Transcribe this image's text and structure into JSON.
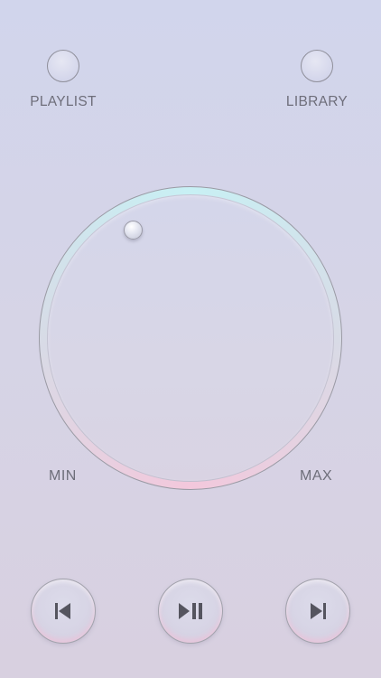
{
  "top_controls": {
    "playlist_label": "PLAYLIST",
    "library_label": "LIBRARY"
  },
  "dial": {
    "min_label": "MIN",
    "max_label": "MAX"
  },
  "playback": {
    "previous_icon": "skip-previous-icon",
    "play_pause_icon": "play-pause-icon",
    "next_icon": "skip-next-icon"
  },
  "colors": {
    "background_top": "#d1d5ec",
    "background_bottom": "#d8d0e0",
    "text": "#6e6e7a",
    "glyph": "#55555f",
    "ring_cyan": "#c8f0f4",
    "ring_pink": "#f3c8dc"
  }
}
